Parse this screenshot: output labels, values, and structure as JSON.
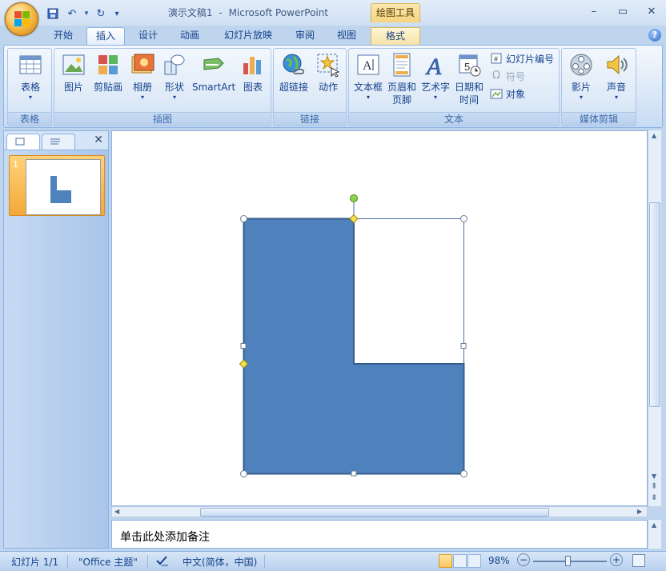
{
  "title": {
    "doc_name": "演示文稿1",
    "separator": "-",
    "app_name": "Microsoft PowerPoint",
    "context_tool": "绘图工具"
  },
  "window_controls": {
    "minimize": "–",
    "maximize": "▭",
    "close": "✕"
  },
  "qat": {
    "save": "💾",
    "undo": "↶",
    "dropdown": "▾",
    "redo": "↻",
    "customize": "▾"
  },
  "tabs": [
    "开始",
    "插入",
    "设计",
    "动画",
    "幻灯片放映",
    "审阅",
    "视图",
    "格式"
  ],
  "active_tab": "插入",
  "help": "?",
  "ribbon": {
    "groups": {
      "table": "表格",
      "illustrations": "插图",
      "links": "链接",
      "text": "文本",
      "media": "媒体剪辑"
    },
    "buttons": {
      "table": "表格",
      "picture": "图片",
      "clipart": "剪贴画",
      "album": "相册",
      "shapes": "形状",
      "smartart": "SmartArt",
      "chart": "图表",
      "hyperlink": "超链接",
      "action": "动作",
      "textbox": "文本框",
      "header_footer_1": "页眉和",
      "header_footer_2": "页脚",
      "wordart": "艺术字",
      "datetime_1": "日期和",
      "datetime_2": "时间",
      "slide_number": "幻灯片编号",
      "symbol": "符号",
      "object": "对象",
      "movie": "影片",
      "sound": "声音"
    },
    "dropdown_arrow": "▾"
  },
  "left_pane": {
    "close": "✕",
    "slide_number": "1"
  },
  "notes": {
    "placeholder": "单击此处添加备注"
  },
  "status": {
    "slide": "幻灯片 1/1",
    "theme": "\"Office 主题\"",
    "language": "中文(简体，中国)",
    "zoom": "98%",
    "zoom_out": "−",
    "zoom_in": "+"
  },
  "colors": {
    "shape_fill": "#4f81bd",
    "shape_stroke": "#385d8a",
    "accent": "#15428b"
  }
}
